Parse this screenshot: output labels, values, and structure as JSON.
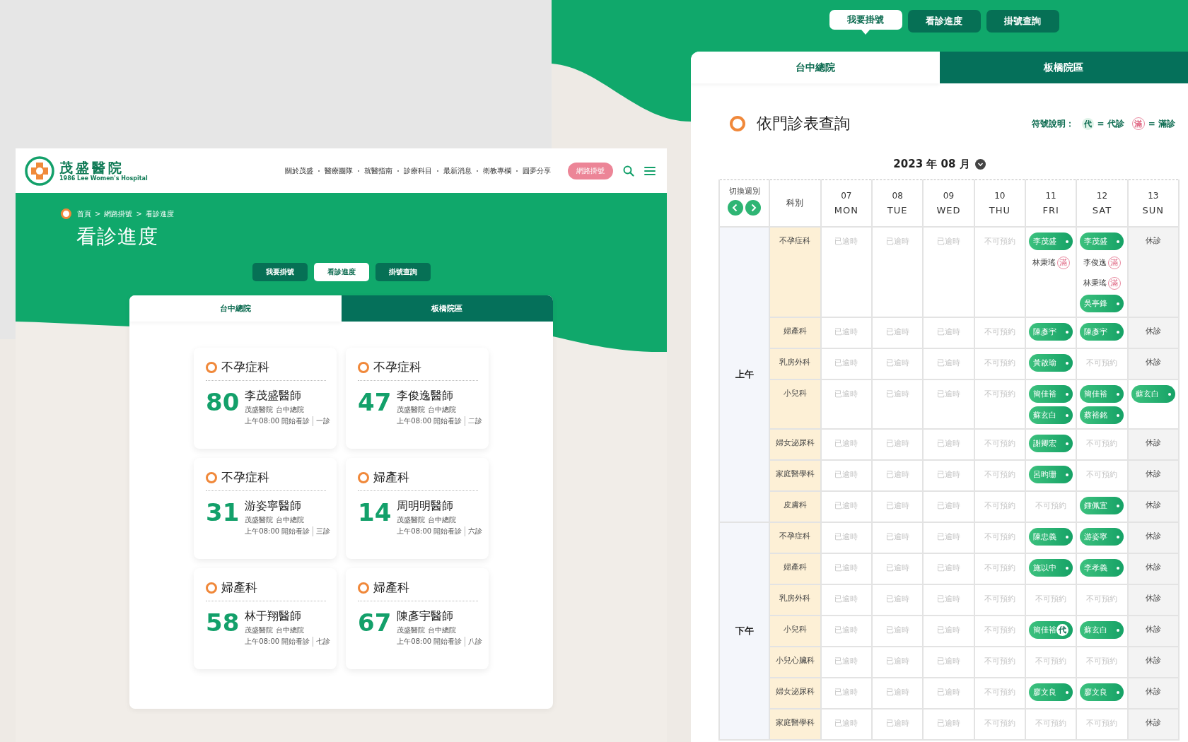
{
  "left_screen": {
    "header": {
      "logo_title": "茂盛醫院",
      "logo_subtitle": "1986 Lee Women's Hospital",
      "nav": [
        "關於茂盛",
        "醫療團隊",
        "就醫指南",
        "診療科目",
        "最新消息",
        "衛教專欄",
        "圓夢分享"
      ],
      "cta": "網路掛號"
    },
    "breadcrumb": [
      {
        "text": "首頁"
      },
      {
        "separator": ">",
        "text": "網路掛號"
      },
      {
        "separator": ">",
        "text": "看診進度"
      }
    ],
    "page_title": "看診進度",
    "tabs": [
      {
        "label": "我要掛號",
        "selected": false
      },
      {
        "label": "看診進度",
        "selected": true
      },
      {
        "label": "掛號查詢",
        "selected": false
      }
    ],
    "branches": [
      {
        "label": "台中總院",
        "selected": true
      },
      {
        "label": "板橋院區",
        "selected": false
      }
    ],
    "cards": [
      {
        "department": "不孕症科",
        "number": "80",
        "doctor": "李茂盛醫師",
        "hospital": "茂盛醫院 台中總院",
        "time": "上午08:00 開始看診",
        "room": "一診"
      },
      {
        "department": "不孕症科",
        "number": "47",
        "doctor": "李俊逸醫師",
        "hospital": "茂盛醫院 台中總院",
        "time": "上午08:00 開始看診",
        "room": "二診"
      },
      {
        "department": "不孕症科",
        "number": "31",
        "doctor": "游姿寧醫師",
        "hospital": "茂盛醫院 台中總院",
        "time": "上午08:00 開始看診",
        "room": "三診"
      },
      {
        "department": "婦產科",
        "number": "14",
        "doctor": "周明明醫師",
        "hospital": "茂盛醫院 台中總院",
        "time": "上午08:00 開始看診",
        "room": "六診"
      },
      {
        "department": "婦產科",
        "number": "58",
        "doctor": "林于翔醫師",
        "hospital": "茂盛醫院 台中總院",
        "time": "上午08:00 開始看診",
        "room": "七診"
      },
      {
        "department": "婦產科",
        "number": "67",
        "doctor": "陳彥宇醫師",
        "hospital": "茂盛醫院 台中總院",
        "time": "上午08:00 開始看診",
        "room": "八診"
      }
    ]
  },
  "right_screen": {
    "tabs": [
      {
        "label": "我要掛號",
        "selected": true
      },
      {
        "label": "看診進度",
        "selected": false
      },
      {
        "label": "掛號查詢",
        "selected": false
      }
    ],
    "branches": [
      {
        "label": "台中總院",
        "selected": true
      },
      {
        "label": "板橋院區",
        "selected": false
      }
    ],
    "title": "依門診表查詢",
    "legend": {
      "label": "符號說明：",
      "items": [
        {
          "kind": "substitute",
          "mark": "代",
          "text": "= 代診"
        },
        {
          "kind": "full",
          "mark": "滿",
          "text": "= 滿診"
        }
      ]
    },
    "month": "2023 年 08 月",
    "table": {
      "week_switch_label": "切換週別",
      "department_header": "科別",
      "days": [
        {
          "date": "07",
          "weekday": "MON"
        },
        {
          "date": "08",
          "weekday": "TUE"
        },
        {
          "date": "09",
          "weekday": "WED"
        },
        {
          "date": "10",
          "weekday": "THU"
        },
        {
          "date": "11",
          "weekday": "FRI"
        },
        {
          "date": "12",
          "weekday": "SAT"
        },
        {
          "date": "13",
          "weekday": "SUN"
        }
      ],
      "periods": [
        {
          "label": "上午",
          "rows": [
            {
              "department": "不孕症科",
              "cells": [
                {
                  "kind": "past",
                  "text": "已逾時"
                },
                {
                  "kind": "past",
                  "text": "已逾時"
                },
                {
                  "kind": "past",
                  "text": "已逾時"
                },
                {
                  "kind": "unavailable",
                  "text": "不可預約"
                },
                {
                  "kind": "doctors",
                  "doctors": [
                    {
                      "name": "李茂盛",
                      "kind": "open"
                    },
                    {
                      "name": "林秉瑤",
                      "kind": "full",
                      "mark": "滿"
                    }
                  ]
                },
                {
                  "kind": "doctors",
                  "doctors": [
                    {
                      "name": "李茂盛",
                      "kind": "open"
                    },
                    {
                      "name": "李俊逸",
                      "kind": "full",
                      "mark": "滿"
                    },
                    {
                      "name": "林秉瑤",
                      "kind": "full",
                      "mark": "滿"
                    },
                    {
                      "name": "吳亭鋒",
                      "kind": "open"
                    }
                  ]
                },
                {
                  "kind": "closed",
                  "text": "休診"
                }
              ]
            },
            {
              "department": "婦產科",
              "cells": [
                {
                  "kind": "past",
                  "text": "已逾時"
                },
                {
                  "kind": "past",
                  "text": "已逾時"
                },
                {
                  "kind": "past",
                  "text": "已逾時"
                },
                {
                  "kind": "unavailable",
                  "text": "不可預約"
                },
                {
                  "kind": "doctors",
                  "doctors": [
                    {
                      "name": "陳彥宇",
                      "kind": "open"
                    }
                  ]
                },
                {
                  "kind": "doctors",
                  "doctors": [
                    {
                      "name": "陳彥宇",
                      "kind": "open"
                    }
                  ]
                },
                {
                  "kind": "closed",
                  "text": "休診"
                }
              ]
            },
            {
              "department": "乳房外科",
              "cells": [
                {
                  "kind": "past",
                  "text": "已逾時"
                },
                {
                  "kind": "past",
                  "text": "已逾時"
                },
                {
                  "kind": "past",
                  "text": "已逾時"
                },
                {
                  "kind": "unavailable",
                  "text": "不可預約"
                },
                {
                  "kind": "doctors",
                  "doctors": [
                    {
                      "name": "黃啟瑜",
                      "kind": "open"
                    }
                  ]
                },
                {
                  "kind": "unavailable",
                  "text": "不可預約"
                },
                {
                  "kind": "closed",
                  "text": "休診"
                }
              ]
            },
            {
              "department": "小兒科",
              "cells": [
                {
                  "kind": "past",
                  "text": "已逾時"
                },
                {
                  "kind": "past",
                  "text": "已逾時"
                },
                {
                  "kind": "past",
                  "text": "已逾時"
                },
                {
                  "kind": "unavailable",
                  "text": "不可預約"
                },
                {
                  "kind": "doctors",
                  "doctors": [
                    {
                      "name": "簡佳裕",
                      "kind": "open"
                    },
                    {
                      "name": "蘇玄白",
                      "kind": "open"
                    }
                  ]
                },
                {
                  "kind": "doctors",
                  "doctors": [
                    {
                      "name": "簡佳裕",
                      "kind": "open"
                    },
                    {
                      "name": "蔡裕銘",
                      "kind": "open"
                    }
                  ]
                },
                {
                  "kind": "doctors",
                  "doctors": [
                    {
                      "name": "蘇玄白",
                      "kind": "open"
                    }
                  ]
                }
              ]
            },
            {
              "department": "婦女泌尿科",
              "cells": [
                {
                  "kind": "past",
                  "text": "已逾時"
                },
                {
                  "kind": "past",
                  "text": "已逾時"
                },
                {
                  "kind": "past",
                  "text": "已逾時"
                },
                {
                  "kind": "unavailable",
                  "text": "不可預約"
                },
                {
                  "kind": "doctors",
                  "doctors": [
                    {
                      "name": "謝卿宏",
                      "kind": "open"
                    }
                  ]
                },
                {
                  "kind": "unavailable",
                  "text": "不可預約"
                },
                {
                  "kind": "closed",
                  "text": "休診"
                }
              ]
            },
            {
              "department": "家庭醫學科",
              "cells": [
                {
                  "kind": "past",
                  "text": "已逾時"
                },
                {
                  "kind": "past",
                  "text": "已逾時"
                },
                {
                  "kind": "past",
                  "text": "已逾時"
                },
                {
                  "kind": "unavailable",
                  "text": "不可預約"
                },
                {
                  "kind": "doctors",
                  "doctors": [
                    {
                      "name": "呂昀珊",
                      "kind": "open"
                    }
                  ]
                },
                {
                  "kind": "unavailable",
                  "text": "不可預約"
                },
                {
                  "kind": "closed",
                  "text": "休診"
                }
              ]
            },
            {
              "department": "皮膚科",
              "cells": [
                {
                  "kind": "past",
                  "text": "已逾時"
                },
                {
                  "kind": "past",
                  "text": "已逾時"
                },
                {
                  "kind": "past",
                  "text": "已逾時"
                },
                {
                  "kind": "unavailable",
                  "text": "不可預約"
                },
                {
                  "kind": "unavailable",
                  "text": "不可預約"
                },
                {
                  "kind": "doctors",
                  "doctors": [
                    {
                      "name": "鍾佩宜",
                      "kind": "open"
                    }
                  ]
                },
                {
                  "kind": "closed",
                  "text": "休診"
                }
              ]
            }
          ]
        },
        {
          "label": "下午",
          "rows": [
            {
              "department": "不孕症科",
              "cells": [
                {
                  "kind": "past",
                  "text": "已逾時"
                },
                {
                  "kind": "past",
                  "text": "已逾時"
                },
                {
                  "kind": "past",
                  "text": "已逾時"
                },
                {
                  "kind": "unavailable",
                  "text": "不可預約"
                },
                {
                  "kind": "doctors",
                  "doctors": [
                    {
                      "name": "陳忠義",
                      "kind": "open"
                    }
                  ]
                },
                {
                  "kind": "doctors",
                  "doctors": [
                    {
                      "name": "游姿寧",
                      "kind": "open"
                    }
                  ]
                },
                {
                  "kind": "closed",
                  "text": "休診"
                }
              ]
            },
            {
              "department": "婦產科",
              "cells": [
                {
                  "kind": "past",
                  "text": "已逾時"
                },
                {
                  "kind": "past",
                  "text": "已逾時"
                },
                {
                  "kind": "past",
                  "text": "已逾時"
                },
                {
                  "kind": "unavailable",
                  "text": "不可預約"
                },
                {
                  "kind": "doctors",
                  "doctors": [
                    {
                      "name": "施以中",
                      "kind": "open"
                    }
                  ]
                },
                {
                  "kind": "doctors",
                  "doctors": [
                    {
                      "name": "李孝義",
                      "kind": "open"
                    }
                  ]
                },
                {
                  "kind": "closed",
                  "text": "休診"
                }
              ]
            },
            {
              "department": "乳房外科",
              "cells": [
                {
                  "kind": "past",
                  "text": "已逾時"
                },
                {
                  "kind": "past",
                  "text": "已逾時"
                },
                {
                  "kind": "past",
                  "text": "已逾時"
                },
                {
                  "kind": "unavailable",
                  "text": "不可預約"
                },
                {
                  "kind": "unavailable",
                  "text": "不可預約"
                },
                {
                  "kind": "unavailable",
                  "text": "不可預約"
                },
                {
                  "kind": "closed",
                  "text": "休診"
                }
              ]
            },
            {
              "department": "小兒科",
              "cells": [
                {
                  "kind": "past",
                  "text": "已逾時"
                },
                {
                  "kind": "past",
                  "text": "已逾時"
                },
                {
                  "kind": "past",
                  "text": "已逾時"
                },
                {
                  "kind": "unavailable",
                  "text": "不可預約"
                },
                {
                  "kind": "doctors",
                  "doctors": [
                    {
                      "name": "簡佳裕",
                      "kind": "substitute",
                      "mark": "代"
                    }
                  ]
                },
                {
                  "kind": "doctors",
                  "doctors": [
                    {
                      "name": "蘇玄白",
                      "kind": "open"
                    }
                  ]
                },
                {
                  "kind": "closed",
                  "text": "休診"
                }
              ]
            },
            {
              "department": "小兒心臟科",
              "cells": [
                {
                  "kind": "past",
                  "text": "已逾時"
                },
                {
                  "kind": "past",
                  "text": "已逾時"
                },
                {
                  "kind": "past",
                  "text": "已逾時"
                },
                {
                  "kind": "unavailable",
                  "text": "不可預約"
                },
                {
                  "kind": "unavailable",
                  "text": "不可預約"
                },
                {
                  "kind": "unavailable",
                  "text": "不可預約"
                },
                {
                  "kind": "closed",
                  "text": "休診"
                }
              ]
            },
            {
              "department": "婦女泌尿科",
              "cells": [
                {
                  "kind": "past",
                  "text": "已逾時"
                },
                {
                  "kind": "past",
                  "text": "已逾時"
                },
                {
                  "kind": "past",
                  "text": "已逾時"
                },
                {
                  "kind": "unavailable",
                  "text": "不可預約"
                },
                {
                  "kind": "doctors",
                  "doctors": [
                    {
                      "name": "廖文良",
                      "kind": "open"
                    }
                  ]
                },
                {
                  "kind": "doctors",
                  "doctors": [
                    {
                      "name": "廖文良",
                      "kind": "open"
                    }
                  ]
                },
                {
                  "kind": "closed",
                  "text": "休診"
                }
              ]
            },
            {
              "department": "家庭醫學科",
              "cells": [
                {
                  "kind": "past",
                  "text": "已逾時"
                },
                {
                  "kind": "past",
                  "text": "已逾時"
                },
                {
                  "kind": "past",
                  "text": "已逾時"
                },
                {
                  "kind": "unavailable",
                  "text": "不可預約"
                },
                {
                  "kind": "unavailable",
                  "text": "不可預約"
                },
                {
                  "kind": "unavailable",
                  "text": "不可預約"
                },
                {
                  "kind": "closed",
                  "text": "休診"
                }
              ]
            }
          ]
        }
      ]
    }
  }
}
